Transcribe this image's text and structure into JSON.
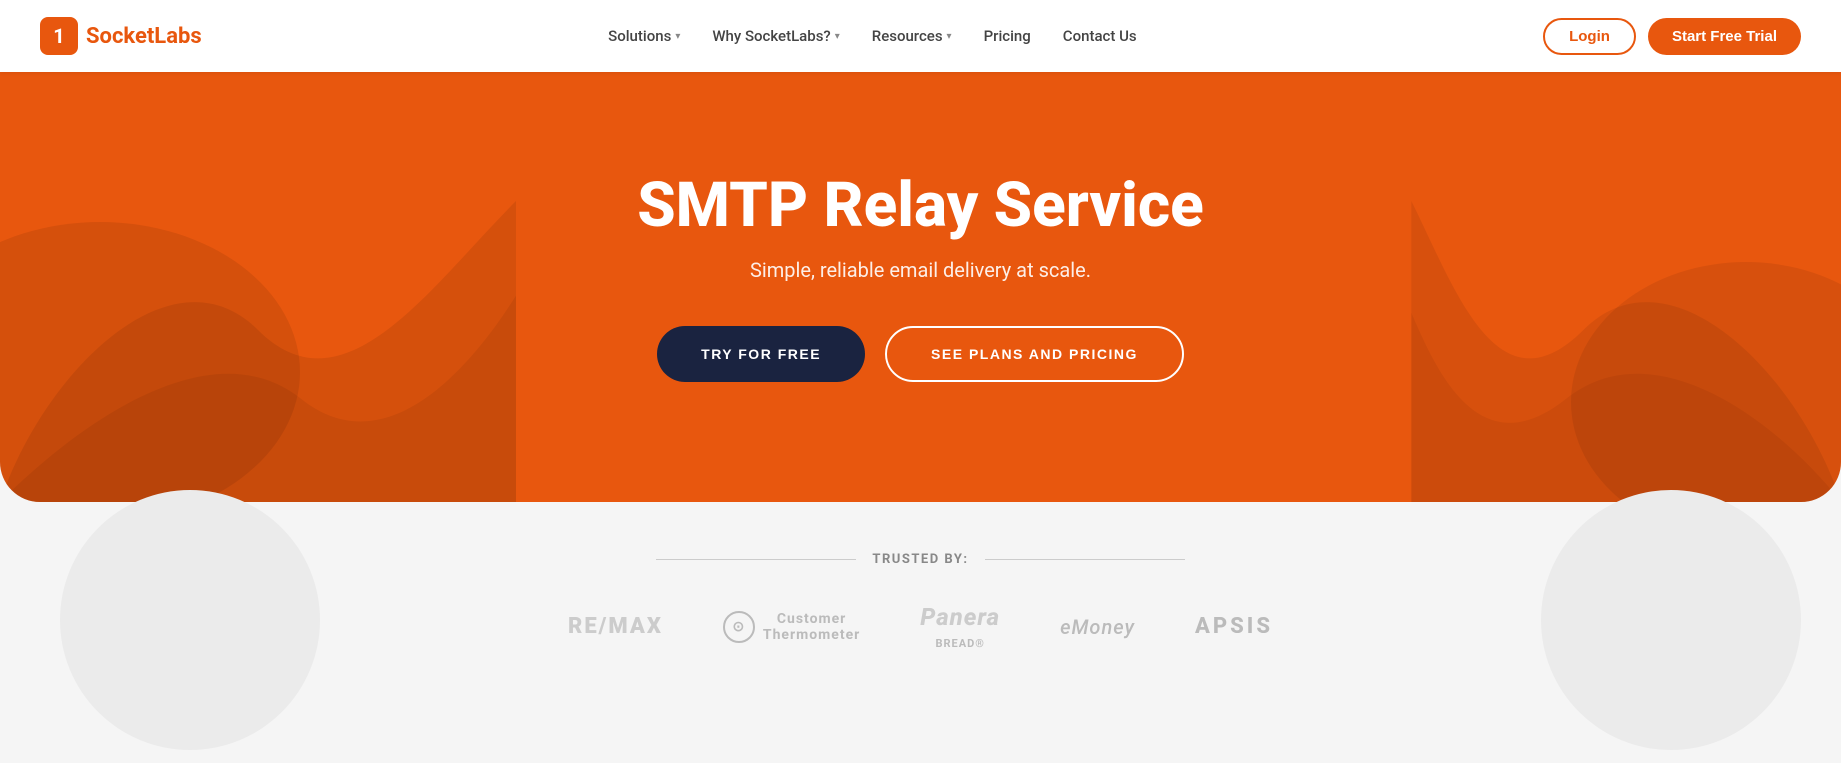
{
  "navbar": {
    "logo_text_regular": "Socket",
    "logo_text_bold": "Labs",
    "logo_icon": "1",
    "nav_items": [
      {
        "label": "Solutions",
        "has_dropdown": true
      },
      {
        "label": "Why SocketLabs?",
        "has_dropdown": true
      },
      {
        "label": "Resources",
        "has_dropdown": true
      },
      {
        "label": "Pricing",
        "has_dropdown": false
      },
      {
        "label": "Contact Us",
        "has_dropdown": false
      }
    ],
    "login_label": "Login",
    "trial_label": "Start Free Trial"
  },
  "hero": {
    "title": "SMTP Relay Service",
    "subtitle": "Simple, reliable email delivery at scale.",
    "try_free_label": "TRY FOR FREE",
    "plans_label": "SEE PLANS AND PRICING"
  },
  "trusted": {
    "label": "TRUSTED BY:",
    "logos": [
      {
        "name": "RE/MAX",
        "type": "remax"
      },
      {
        "name": "Customer Thermometer",
        "type": "customer-therm"
      },
      {
        "name": "Panera Bread",
        "type": "panera"
      },
      {
        "name": "eMoney",
        "type": "emoney"
      },
      {
        "name": "APSIS",
        "type": "apsis"
      }
    ]
  },
  "colors": {
    "orange": "#e8570e",
    "dark_navy": "#1a2340",
    "white": "#ffffff",
    "gray_text": "#555555",
    "logo_gray": "#cccccc"
  }
}
